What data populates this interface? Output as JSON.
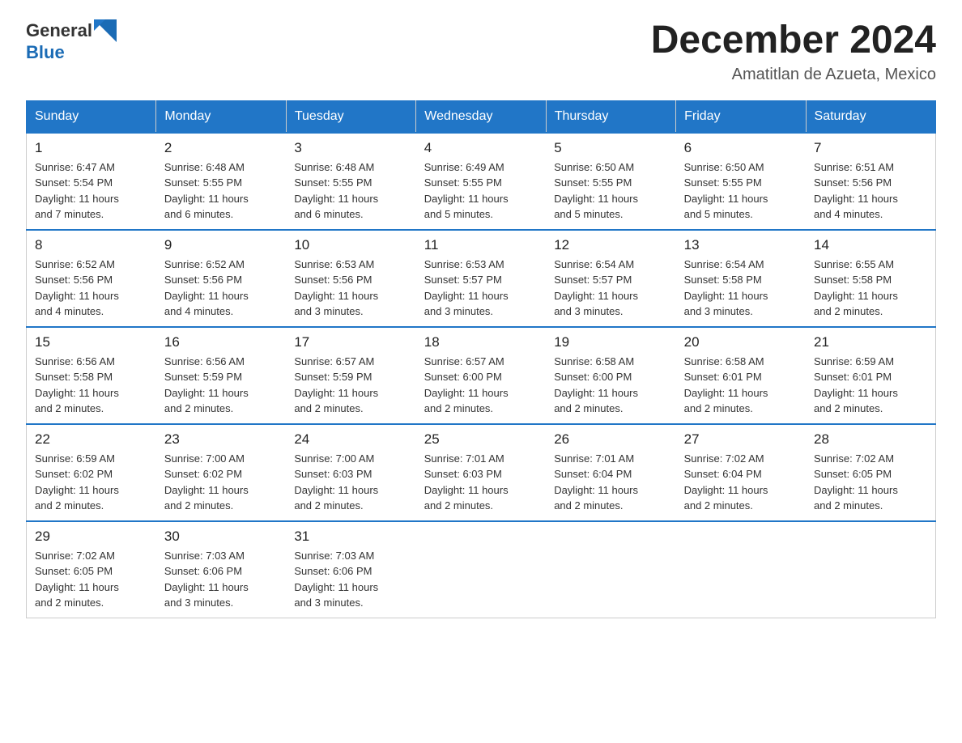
{
  "header": {
    "logo_general": "General",
    "logo_blue": "Blue",
    "month_title": "December 2024",
    "location": "Amatitlan de Azueta, Mexico"
  },
  "days_of_week": [
    "Sunday",
    "Monday",
    "Tuesday",
    "Wednesday",
    "Thursday",
    "Friday",
    "Saturday"
  ],
  "weeks": [
    [
      {
        "day": "1",
        "sunrise": "6:47 AM",
        "sunset": "5:54 PM",
        "daylight": "11 hours and 7 minutes."
      },
      {
        "day": "2",
        "sunrise": "6:48 AM",
        "sunset": "5:55 PM",
        "daylight": "11 hours and 6 minutes."
      },
      {
        "day": "3",
        "sunrise": "6:48 AM",
        "sunset": "5:55 PM",
        "daylight": "11 hours and 6 minutes."
      },
      {
        "day": "4",
        "sunrise": "6:49 AM",
        "sunset": "5:55 PM",
        "daylight": "11 hours and 5 minutes."
      },
      {
        "day": "5",
        "sunrise": "6:50 AM",
        "sunset": "5:55 PM",
        "daylight": "11 hours and 5 minutes."
      },
      {
        "day": "6",
        "sunrise": "6:50 AM",
        "sunset": "5:55 PM",
        "daylight": "11 hours and 5 minutes."
      },
      {
        "day": "7",
        "sunrise": "6:51 AM",
        "sunset": "5:56 PM",
        "daylight": "11 hours and 4 minutes."
      }
    ],
    [
      {
        "day": "8",
        "sunrise": "6:52 AM",
        "sunset": "5:56 PM",
        "daylight": "11 hours and 4 minutes."
      },
      {
        "day": "9",
        "sunrise": "6:52 AM",
        "sunset": "5:56 PM",
        "daylight": "11 hours and 4 minutes."
      },
      {
        "day": "10",
        "sunrise": "6:53 AM",
        "sunset": "5:56 PM",
        "daylight": "11 hours and 3 minutes."
      },
      {
        "day": "11",
        "sunrise": "6:53 AM",
        "sunset": "5:57 PM",
        "daylight": "11 hours and 3 minutes."
      },
      {
        "day": "12",
        "sunrise": "6:54 AM",
        "sunset": "5:57 PM",
        "daylight": "11 hours and 3 minutes."
      },
      {
        "day": "13",
        "sunrise": "6:54 AM",
        "sunset": "5:58 PM",
        "daylight": "11 hours and 3 minutes."
      },
      {
        "day": "14",
        "sunrise": "6:55 AM",
        "sunset": "5:58 PM",
        "daylight": "11 hours and 2 minutes."
      }
    ],
    [
      {
        "day": "15",
        "sunrise": "6:56 AM",
        "sunset": "5:58 PM",
        "daylight": "11 hours and 2 minutes."
      },
      {
        "day": "16",
        "sunrise": "6:56 AM",
        "sunset": "5:59 PM",
        "daylight": "11 hours and 2 minutes."
      },
      {
        "day": "17",
        "sunrise": "6:57 AM",
        "sunset": "5:59 PM",
        "daylight": "11 hours and 2 minutes."
      },
      {
        "day": "18",
        "sunrise": "6:57 AM",
        "sunset": "6:00 PM",
        "daylight": "11 hours and 2 minutes."
      },
      {
        "day": "19",
        "sunrise": "6:58 AM",
        "sunset": "6:00 PM",
        "daylight": "11 hours and 2 minutes."
      },
      {
        "day": "20",
        "sunrise": "6:58 AM",
        "sunset": "6:01 PM",
        "daylight": "11 hours and 2 minutes."
      },
      {
        "day": "21",
        "sunrise": "6:59 AM",
        "sunset": "6:01 PM",
        "daylight": "11 hours and 2 minutes."
      }
    ],
    [
      {
        "day": "22",
        "sunrise": "6:59 AM",
        "sunset": "6:02 PM",
        "daylight": "11 hours and 2 minutes."
      },
      {
        "day": "23",
        "sunrise": "7:00 AM",
        "sunset": "6:02 PM",
        "daylight": "11 hours and 2 minutes."
      },
      {
        "day": "24",
        "sunrise": "7:00 AM",
        "sunset": "6:03 PM",
        "daylight": "11 hours and 2 minutes."
      },
      {
        "day": "25",
        "sunrise": "7:01 AM",
        "sunset": "6:03 PM",
        "daylight": "11 hours and 2 minutes."
      },
      {
        "day": "26",
        "sunrise": "7:01 AM",
        "sunset": "6:04 PM",
        "daylight": "11 hours and 2 minutes."
      },
      {
        "day": "27",
        "sunrise": "7:02 AM",
        "sunset": "6:04 PM",
        "daylight": "11 hours and 2 minutes."
      },
      {
        "day": "28",
        "sunrise": "7:02 AM",
        "sunset": "6:05 PM",
        "daylight": "11 hours and 2 minutes."
      }
    ],
    [
      {
        "day": "29",
        "sunrise": "7:02 AM",
        "sunset": "6:05 PM",
        "daylight": "11 hours and 2 minutes."
      },
      {
        "day": "30",
        "sunrise": "7:03 AM",
        "sunset": "6:06 PM",
        "daylight": "11 hours and 3 minutes."
      },
      {
        "day": "31",
        "sunrise": "7:03 AM",
        "sunset": "6:06 PM",
        "daylight": "11 hours and 3 minutes."
      },
      null,
      null,
      null,
      null
    ]
  ],
  "labels": {
    "sunrise": "Sunrise:",
    "sunset": "Sunset:",
    "daylight": "Daylight:"
  }
}
